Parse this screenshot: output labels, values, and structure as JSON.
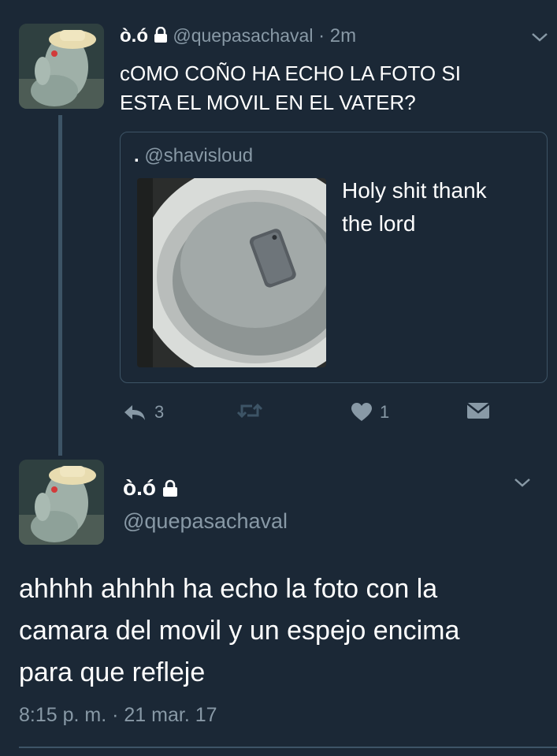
{
  "tweet1": {
    "display_name": "ò.ó",
    "handle": "@quepasachaval",
    "separator": "·",
    "time": "2m",
    "text_line1": "cOMO COÑO HA ECHO LA FOTO SI",
    "text_line2": "ESTA EL MOVIL EN EL VATER?",
    "avatar_icon": "statue-avatar-icon",
    "quote": {
      "display_name": ".",
      "handle": "@shavisloud",
      "text_line1": "Holy shit thank",
      "text_line2": "the lord",
      "image_icon": "phone-in-toilet-image"
    },
    "actions": {
      "reply_count": "3",
      "like_count": "1"
    }
  },
  "tweet2": {
    "display_name": "ò.ó",
    "handle": "@quepasachaval",
    "text_line1": "ahhhh ahhhh ha echo la foto con la",
    "text_line2": "camara del movil y un espejo encima",
    "text_line3": "para que refleje",
    "timestamp": "8:15 p. m. · 21 mar. 17"
  },
  "colors": {
    "background": "#1b2836",
    "muted": "#8899a6",
    "border": "#3d5466"
  }
}
